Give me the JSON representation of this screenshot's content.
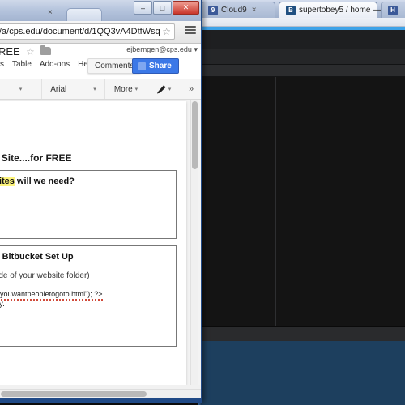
{
  "background_window": {
    "app": "Cloud9 IDE / Chrome",
    "tabs": [
      {
        "label": "Cloud9",
        "favicon": "cloud9-icon",
        "active": false,
        "close_label": "×"
      },
      {
        "label": "supertobey5 / home — B",
        "favicon": "bitbucket-icon",
        "active": true,
        "close_label": "×"
      },
      {
        "label": "",
        "favicon": "generic-site-icon",
        "active": false,
        "close_label": "×"
      }
    ],
    "editor": {
      "accent_color": "#3da2e8",
      "editor_bg": "#141414",
      "console_bg": "#1d3f5e"
    }
  },
  "foreground_window": {
    "window_controls": {
      "minimize": "–",
      "maximize": "□",
      "close": "✕"
    },
    "tab_close_label": "×",
    "omnibox": {
      "url": "/a/cps.edu/document/d/1QQ3vA4DtfWsqi",
      "star_icon": "☆",
      "menu_icon": "hamburger-icon"
    },
    "google_docs": {
      "title": "REE",
      "account_email": "ejberngen@cps.edu",
      "account_caret": "▾",
      "menus": [
        "s",
        "Table",
        "Add-ons",
        "Hel"
      ],
      "comments_label": "Comments",
      "share_label": "Share",
      "toolbar": {
        "first_caret": "▾",
        "font_name": "Arial",
        "font_caret": "▾",
        "more_label": "More",
        "more_caret": "▾",
        "pen_caret": "▾",
        "collapse_icon": "»"
      },
      "document": {
        "heading1": "Your Site....for FREE",
        "question1_highlight": "ebsites",
        "question1_rest": " will we need?",
        "answer1": "]",
        "heading2": "and Bitbucket Set Up",
        "line1": "(inside of your website folder)",
        "code_prefix": "pageyouwantpeopletogoto.html\"); ?>",
        "code_tail": "sitory.",
        "bold_fragment": "n"
      }
    }
  }
}
